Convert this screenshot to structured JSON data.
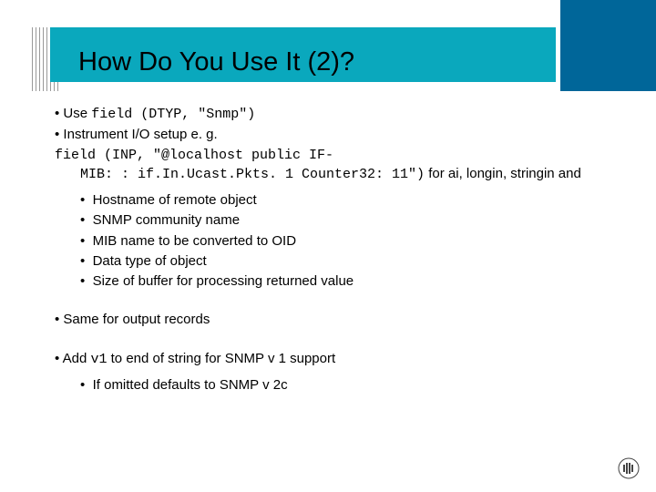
{
  "title": "How Do You Use It (2)?",
  "b1_pre": "Use ",
  "b1_code": "field (DTYP, \"Snmp\")",
  "b2": " Instrument I/O setup e. g.",
  "b2_code_line1": "field (INP, \"@localhost public IF-",
  "b2_code_line2a": "MIB: : if.In.Ucast.Pkts. 1 Counter32: 11\")",
  "b2_tail": " for ai, longin, stringin and",
  "sub": [
    "Hostname of remote object",
    "SNMP community name",
    "MIB name to be converted to OID",
    "Data type of object",
    "Size of buffer for processing returned value"
  ],
  "b3": "Same for output records",
  "b4_pre": "Add ",
  "b4_code": "v1",
  "b4_post": " to end of string for SNMP v 1 support",
  "b4_sub": "If omitted defaults to SNMP v 2c"
}
